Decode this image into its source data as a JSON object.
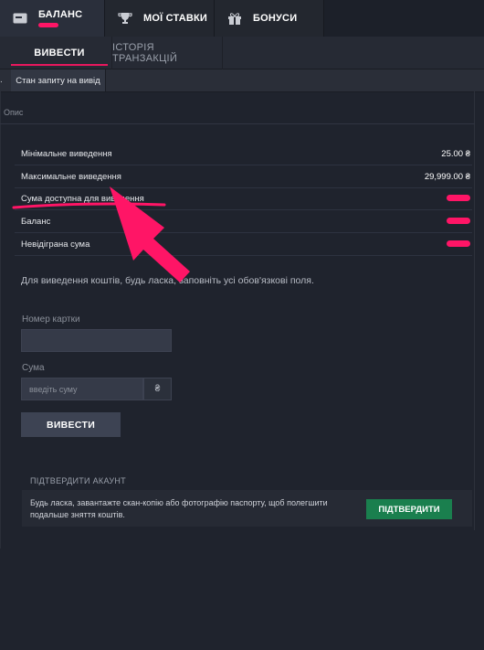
{
  "top_tabs": {
    "balance": {
      "label": "БАЛАНС",
      "icon": "wallet-icon"
    },
    "my_bets": {
      "label": "МОЇ СТАВКИ",
      "icon": "trophy-icon"
    },
    "bonuses": {
      "label": "БОНУСИ",
      "icon": "gift-icon"
    }
  },
  "sub_tabs": {
    "withdraw": "ВИВЕСТИ",
    "history": "ІСТОРІЯ ТРАНЗАКЦІЙ"
  },
  "nav3": {
    "dot": ".",
    "item": "Стан запиту на вивід"
  },
  "description_label": "Опис",
  "info_rows": [
    {
      "label": "Мінімальне виведення",
      "value": "25.00 ₴"
    },
    {
      "label": "Максимальне виведення",
      "value": "29,999.00 ₴"
    },
    {
      "label": "Сума доступна для виведення",
      "value": ""
    },
    {
      "label": "Баланс",
      "value": ""
    },
    {
      "label": "Невідіграна сума",
      "value": ""
    }
  ],
  "instruction": "Для виведення коштів, будь ласка, заповніть усі обов'язкові поля.",
  "form": {
    "card_label": "Номер картки",
    "card_value": "",
    "amount_label": "Сума",
    "amount_placeholder": "введіть суму",
    "currency": "₴",
    "submit": "ВИВЕСТИ"
  },
  "verify": {
    "title": "ПІДТВЕРДИТИ АКАУНТ",
    "text": "Будь ласка, завантажте скан-копію або фотографію паспорту, щоб полегшити подальше зняття коштів.",
    "button": "ПІДТВЕРДИТИ"
  },
  "colors": {
    "background": "#1f232d",
    "accent": "#e8175d",
    "annotation": "#ff1566",
    "verify_button": "#1a7f4e"
  }
}
